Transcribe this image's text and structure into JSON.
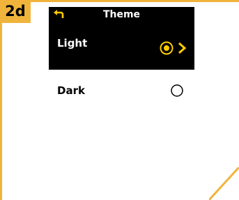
{
  "step": {
    "label": "2d"
  },
  "header": {
    "title": "Theme",
    "back_icon": "back-arrow-icon"
  },
  "menu": {
    "items": [
      {
        "label": "Light",
        "selected": true,
        "has_submenu": true
      },
      {
        "label": "Dark",
        "selected": false,
        "has_submenu": false
      }
    ]
  },
  "colors": {
    "accent": "#f0b43c",
    "selected_radio": "#ffcc00",
    "screen_bg": "#000000",
    "page_bg": "#ffffff"
  }
}
